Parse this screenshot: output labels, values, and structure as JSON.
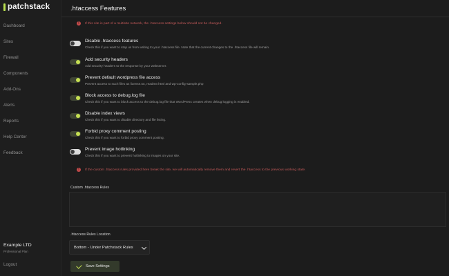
{
  "brand": {
    "name": "patchstack",
    "accent": "#c6e052"
  },
  "sidebar": {
    "items": [
      {
        "label": "Dashboard"
      },
      {
        "label": "Sites"
      },
      {
        "label": "Firewall"
      },
      {
        "label": "Components"
      },
      {
        "label": "Add-Ons"
      },
      {
        "label": "Alerts"
      },
      {
        "label": "Reports"
      },
      {
        "label": "Help Center"
      },
      {
        "label": "Feedback"
      }
    ],
    "org_name": "Example LTD",
    "org_plan": "Professional Plan",
    "logout": "Logout"
  },
  "page": {
    "title": ".htaccess Features",
    "multisite_warning": "If this site is part of a multisite network, the .htaccess settings below should not be changed.",
    "custom_rules_warning": "If the custom .htaccess rules provided here break the site, we will automatically remove them and revert the .htaccess to the previous working state."
  },
  "settings": [
    {
      "title": "Disable .htaccess features",
      "desc": "Check this if you want to stop us from writing to your .htaccess file. Note that the current changes to the .htaccess file will remain.",
      "enabled": false
    },
    {
      "title": "Add security headers",
      "desc": "Add security headers to the response by your webserver.",
      "enabled": true
    },
    {
      "title": "Prevent default wordpress file access",
      "desc": "Prevent access to such files as license.txt, readme.html and wp-config-sample.php",
      "enabled": true
    },
    {
      "title": "Block access to debug.log file",
      "desc": "Check this if you want to block access to the debug.log file that WordPress creates when debug logging is enabled.",
      "enabled": true
    },
    {
      "title": "Disable index views",
      "desc": "Check this if you want to disable directory and file listing.",
      "enabled": true
    },
    {
      "title": "Forbid proxy comment posting",
      "desc": "Check this if you want to forbid proxy comment posting.",
      "enabled": true
    },
    {
      "title": "Prevent image hotlinking",
      "desc": "Check this if you want to prevent hotlinking to images on your site.",
      "enabled": false
    }
  ],
  "custom_rules": {
    "label": "Custom .htaccess Rules",
    "value": ""
  },
  "location": {
    "label": ".htaccess Rules Location",
    "selected": "Bottom - Under Patchstack Rules"
  },
  "save_button": "Save Settings"
}
